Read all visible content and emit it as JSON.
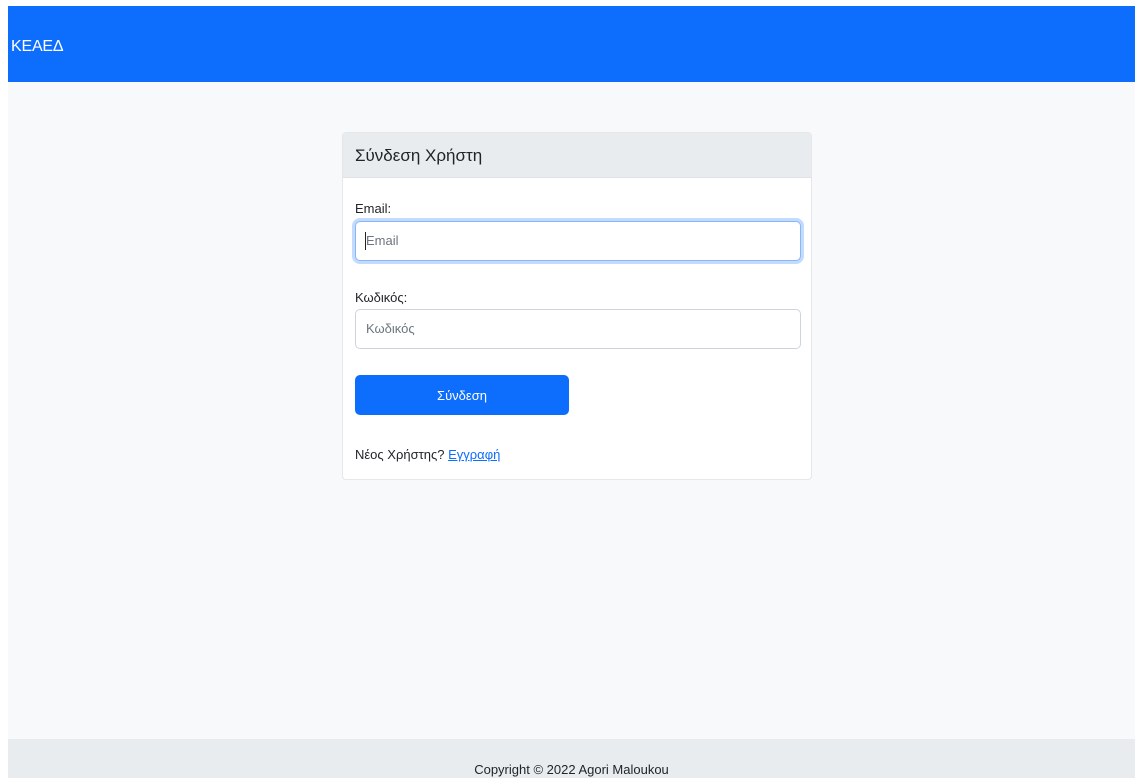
{
  "navbar": {
    "brand": "ΚΕΑΕΔ"
  },
  "login_card": {
    "title": "Σύνδεση Χρήστη",
    "email": {
      "label": "Email:",
      "placeholder": "Email",
      "value": ""
    },
    "password": {
      "label": "Κωδικός:",
      "placeholder": "Κωδικός",
      "value": ""
    },
    "submit_label": "Σύνδεση",
    "register_prompt": "Νέος Χρήστης?",
    "register_link": "Εγγραφή"
  },
  "footer": {
    "text": "Copyright © 2022 Agori Maloukou"
  },
  "colors": {
    "primary": "#0d6efd",
    "page_background": "#f8f9fa",
    "card_header": "#e9ecef"
  }
}
